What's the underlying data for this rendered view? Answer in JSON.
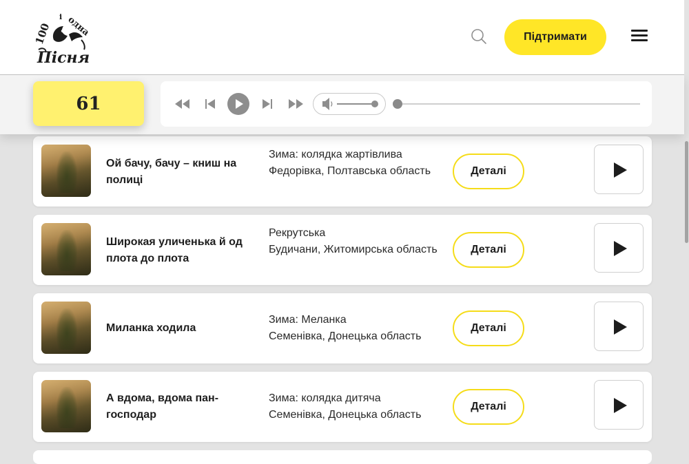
{
  "header": {
    "logo_text_top": "1000 і одна",
    "logo_text_bottom": "Пісня",
    "support_label": "Підтримати"
  },
  "player": {
    "counter": "61",
    "volume_level": 1.0,
    "progress": 0.0
  },
  "songs": [
    {
      "title": "Ой бачу, бачу – книш на полиці",
      "genre": "Зима: колядка жартівлива",
      "location": "Федорівка, Полтавська область",
      "details_label": "Деталі"
    },
    {
      "title": "Широкая уличенька й од плота до плота",
      "genre": "Рекрутська",
      "location": "Будичани, Житомирська область",
      "details_label": "Деталі"
    },
    {
      "title": "Миланка ходила",
      "genre": "Зима: Меланка",
      "location": "Семенівка, Донецька область",
      "details_label": "Деталі"
    },
    {
      "title": "А вдома, вдома пан-господар",
      "genre": "Зима: колядка дитяча",
      "location": "Семенівка, Донецька область",
      "details_label": "Деталі"
    }
  ],
  "colors": {
    "accent_yellow": "#ffe627",
    "counter_yellow": "#fff16f",
    "details_border": "#f5dc18"
  },
  "icons": [
    "search-icon",
    "hamburger-menu-icon",
    "rewind-icon",
    "previous-track-icon",
    "play-icon",
    "next-track-icon",
    "fast-forward-icon",
    "volume-icon"
  ]
}
